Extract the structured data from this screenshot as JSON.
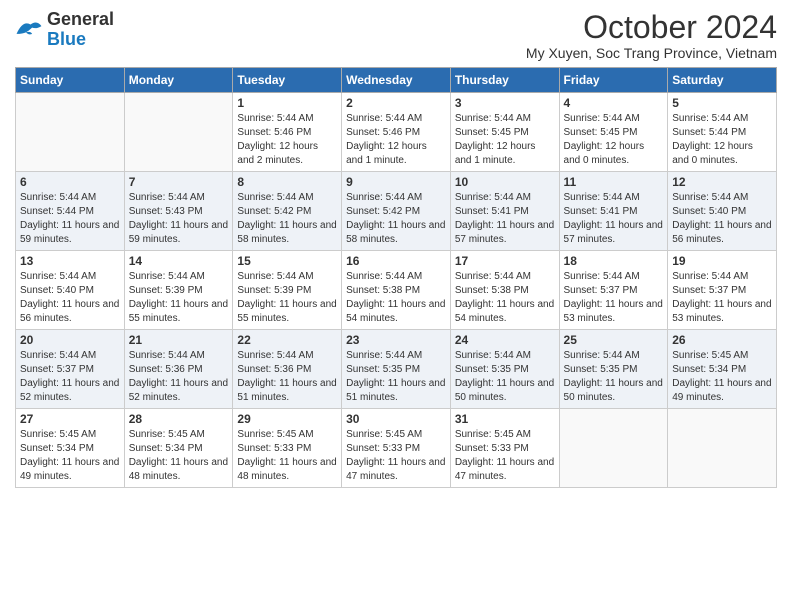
{
  "header": {
    "logo_line1": "General",
    "logo_line2": "Blue",
    "month_title": "October 2024",
    "location": "My Xuyen, Soc Trang Province, Vietnam"
  },
  "days_of_week": [
    "Sunday",
    "Monday",
    "Tuesday",
    "Wednesday",
    "Thursday",
    "Friday",
    "Saturday"
  ],
  "weeks": [
    {
      "days": [
        {
          "num": "",
          "sunrise": "",
          "sunset": "",
          "daylight": ""
        },
        {
          "num": "",
          "sunrise": "",
          "sunset": "",
          "daylight": ""
        },
        {
          "num": "1",
          "sunrise": "Sunrise: 5:44 AM",
          "sunset": "Sunset: 5:46 PM",
          "daylight": "Daylight: 12 hours and 2 minutes."
        },
        {
          "num": "2",
          "sunrise": "Sunrise: 5:44 AM",
          "sunset": "Sunset: 5:46 PM",
          "daylight": "Daylight: 12 hours and 1 minute."
        },
        {
          "num": "3",
          "sunrise": "Sunrise: 5:44 AM",
          "sunset": "Sunset: 5:45 PM",
          "daylight": "Daylight: 12 hours and 1 minute."
        },
        {
          "num": "4",
          "sunrise": "Sunrise: 5:44 AM",
          "sunset": "Sunset: 5:45 PM",
          "daylight": "Daylight: 12 hours and 0 minutes."
        },
        {
          "num": "5",
          "sunrise": "Sunrise: 5:44 AM",
          "sunset": "Sunset: 5:44 PM",
          "daylight": "Daylight: 12 hours and 0 minutes."
        }
      ]
    },
    {
      "days": [
        {
          "num": "6",
          "sunrise": "Sunrise: 5:44 AM",
          "sunset": "Sunset: 5:44 PM",
          "daylight": "Daylight: 11 hours and 59 minutes."
        },
        {
          "num": "7",
          "sunrise": "Sunrise: 5:44 AM",
          "sunset": "Sunset: 5:43 PM",
          "daylight": "Daylight: 11 hours and 59 minutes."
        },
        {
          "num": "8",
          "sunrise": "Sunrise: 5:44 AM",
          "sunset": "Sunset: 5:42 PM",
          "daylight": "Daylight: 11 hours and 58 minutes."
        },
        {
          "num": "9",
          "sunrise": "Sunrise: 5:44 AM",
          "sunset": "Sunset: 5:42 PM",
          "daylight": "Daylight: 11 hours and 58 minutes."
        },
        {
          "num": "10",
          "sunrise": "Sunrise: 5:44 AM",
          "sunset": "Sunset: 5:41 PM",
          "daylight": "Daylight: 11 hours and 57 minutes."
        },
        {
          "num": "11",
          "sunrise": "Sunrise: 5:44 AM",
          "sunset": "Sunset: 5:41 PM",
          "daylight": "Daylight: 11 hours and 57 minutes."
        },
        {
          "num": "12",
          "sunrise": "Sunrise: 5:44 AM",
          "sunset": "Sunset: 5:40 PM",
          "daylight": "Daylight: 11 hours and 56 minutes."
        }
      ]
    },
    {
      "days": [
        {
          "num": "13",
          "sunrise": "Sunrise: 5:44 AM",
          "sunset": "Sunset: 5:40 PM",
          "daylight": "Daylight: 11 hours and 56 minutes."
        },
        {
          "num": "14",
          "sunrise": "Sunrise: 5:44 AM",
          "sunset": "Sunset: 5:39 PM",
          "daylight": "Daylight: 11 hours and 55 minutes."
        },
        {
          "num": "15",
          "sunrise": "Sunrise: 5:44 AM",
          "sunset": "Sunset: 5:39 PM",
          "daylight": "Daylight: 11 hours and 55 minutes."
        },
        {
          "num": "16",
          "sunrise": "Sunrise: 5:44 AM",
          "sunset": "Sunset: 5:38 PM",
          "daylight": "Daylight: 11 hours and 54 minutes."
        },
        {
          "num": "17",
          "sunrise": "Sunrise: 5:44 AM",
          "sunset": "Sunset: 5:38 PM",
          "daylight": "Daylight: 11 hours and 54 minutes."
        },
        {
          "num": "18",
          "sunrise": "Sunrise: 5:44 AM",
          "sunset": "Sunset: 5:37 PM",
          "daylight": "Daylight: 11 hours and 53 minutes."
        },
        {
          "num": "19",
          "sunrise": "Sunrise: 5:44 AM",
          "sunset": "Sunset: 5:37 PM",
          "daylight": "Daylight: 11 hours and 53 minutes."
        }
      ]
    },
    {
      "days": [
        {
          "num": "20",
          "sunrise": "Sunrise: 5:44 AM",
          "sunset": "Sunset: 5:37 PM",
          "daylight": "Daylight: 11 hours and 52 minutes."
        },
        {
          "num": "21",
          "sunrise": "Sunrise: 5:44 AM",
          "sunset": "Sunset: 5:36 PM",
          "daylight": "Daylight: 11 hours and 52 minutes."
        },
        {
          "num": "22",
          "sunrise": "Sunrise: 5:44 AM",
          "sunset": "Sunset: 5:36 PM",
          "daylight": "Daylight: 11 hours and 51 minutes."
        },
        {
          "num": "23",
          "sunrise": "Sunrise: 5:44 AM",
          "sunset": "Sunset: 5:35 PM",
          "daylight": "Daylight: 11 hours and 51 minutes."
        },
        {
          "num": "24",
          "sunrise": "Sunrise: 5:44 AM",
          "sunset": "Sunset: 5:35 PM",
          "daylight": "Daylight: 11 hours and 50 minutes."
        },
        {
          "num": "25",
          "sunrise": "Sunrise: 5:44 AM",
          "sunset": "Sunset: 5:35 PM",
          "daylight": "Daylight: 11 hours and 50 minutes."
        },
        {
          "num": "26",
          "sunrise": "Sunrise: 5:45 AM",
          "sunset": "Sunset: 5:34 PM",
          "daylight": "Daylight: 11 hours and 49 minutes."
        }
      ]
    },
    {
      "days": [
        {
          "num": "27",
          "sunrise": "Sunrise: 5:45 AM",
          "sunset": "Sunset: 5:34 PM",
          "daylight": "Daylight: 11 hours and 49 minutes."
        },
        {
          "num": "28",
          "sunrise": "Sunrise: 5:45 AM",
          "sunset": "Sunset: 5:34 PM",
          "daylight": "Daylight: 11 hours and 48 minutes."
        },
        {
          "num": "29",
          "sunrise": "Sunrise: 5:45 AM",
          "sunset": "Sunset: 5:33 PM",
          "daylight": "Daylight: 11 hours and 48 minutes."
        },
        {
          "num": "30",
          "sunrise": "Sunrise: 5:45 AM",
          "sunset": "Sunset: 5:33 PM",
          "daylight": "Daylight: 11 hours and 47 minutes."
        },
        {
          "num": "31",
          "sunrise": "Sunrise: 5:45 AM",
          "sunset": "Sunset: 5:33 PM",
          "daylight": "Daylight: 11 hours and 47 minutes."
        },
        {
          "num": "",
          "sunrise": "",
          "sunset": "",
          "daylight": ""
        },
        {
          "num": "",
          "sunrise": "",
          "sunset": "",
          "daylight": ""
        }
      ]
    }
  ]
}
